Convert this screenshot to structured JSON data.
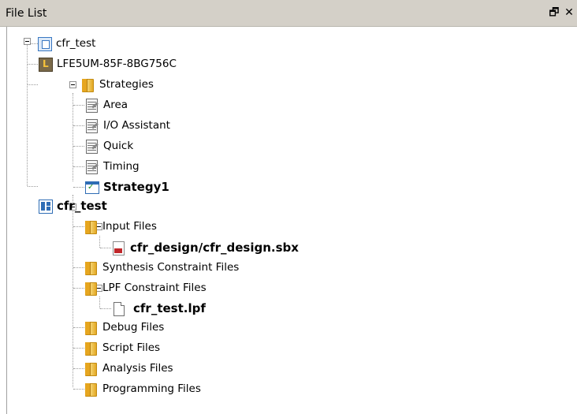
{
  "panel": {
    "title": "File List",
    "float_glyph": "🗗",
    "close_glyph": "✕"
  },
  "tree": {
    "root": "cfr_test",
    "device": "LFE5UM-85F-8BG756C",
    "strategies_folder": "Strategies",
    "strategies": [
      "Area",
      "I/O Assistant",
      "Quick",
      "Timing",
      "Strategy1"
    ],
    "implementation": "cfr_test",
    "input_files_folder": "Input Files",
    "input_file": "cfr_design/cfr_design.sbx",
    "synthesis_folder": "Synthesis Constraint Files",
    "lpf_folder": "LPF Constraint Files",
    "lpf_file": "cfr_test.lpf",
    "debug_folder": "Debug Files",
    "script_folder": "Script Files",
    "analysis_folder": "Analysis Files",
    "programming_folder": "Programming Files"
  },
  "icons": {
    "project": "project-icon",
    "device": "device-chip-icon",
    "folder": "folder-icon",
    "strategy": "strategy-icon",
    "active_strategy": "active-strategy-icon",
    "implementation": "implementation-icon",
    "source": "sbx-source-icon",
    "document": "document-icon"
  },
  "colors": {
    "titlebar": "#d4d0c8",
    "folder": "#f2c14e",
    "accent_blue": "#2f6db5"
  }
}
